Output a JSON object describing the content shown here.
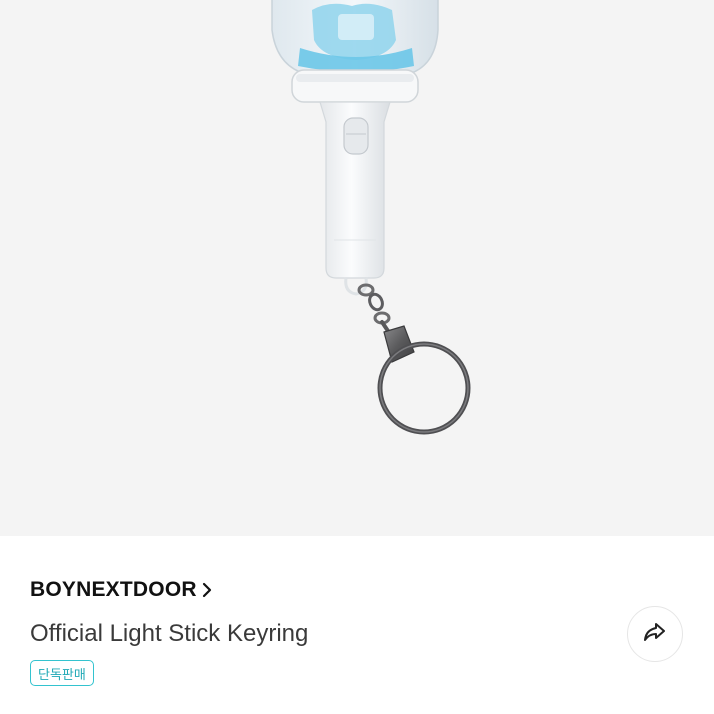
{
  "product": {
    "brand": "BOYNEXTDOOR",
    "title": "Official Light Stick Keyring",
    "badge": "단독판매"
  },
  "icons": {
    "brand_chevron": "chevron-right-icon",
    "share": "share-arrow-icon"
  },
  "colors": {
    "image_background": "#f4f4f4",
    "badge_accent": "#33c3cf",
    "text_primary": "#111111",
    "text_secondary": "#3a3a3a"
  }
}
